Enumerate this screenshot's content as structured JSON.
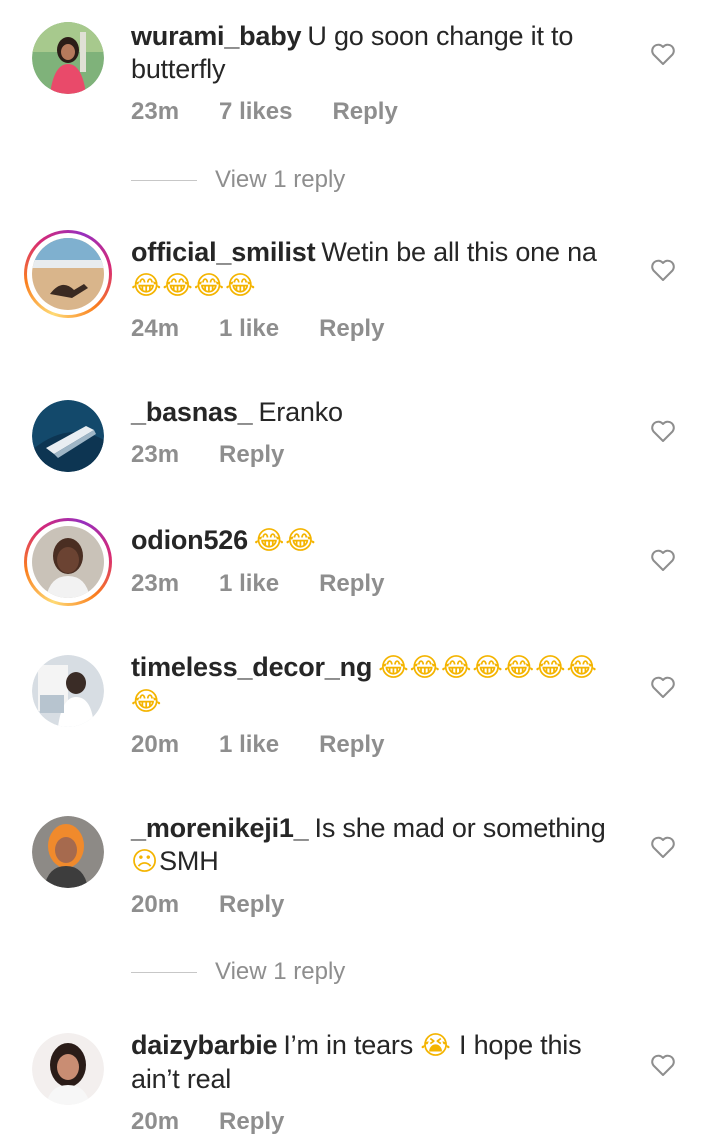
{
  "comments": [
    {
      "username": "wurami_baby",
      "text_1": "U go soon change it to",
      "text_2": "butterfly",
      "time": "23m",
      "likes": "7 likes",
      "reply": "Reply"
    },
    {
      "username": "official_smilist",
      "text_1": "Wetin be all this one na",
      "emoji": "😂😂😂😂",
      "time": "24m",
      "likes": "1 like",
      "reply": "Reply"
    },
    {
      "username": "_basnas_",
      "text_1": "Eranko",
      "time": "23m",
      "reply": "Reply"
    },
    {
      "username": "odion526",
      "emoji": "😂😂",
      "time": "23m",
      "likes": "1 like",
      "reply": "Reply"
    },
    {
      "username": "timeless_decor_ng",
      "emoji_1": "😂😂😂😂😂😂😂",
      "emoji_2": "😂",
      "time": "20m",
      "likes": "1 like",
      "reply": "Reply"
    },
    {
      "username": "_morenikeji1_",
      "text_1": "Is she mad or something",
      "emoji": "☹",
      "text_2": "SMH",
      "time": "20m",
      "reply": "Reply"
    },
    {
      "username": "daizybarbie",
      "text_1a": "I’m in tears",
      "emoji": "😭",
      "text_1b": "I hope this",
      "text_2": "ain’t real",
      "time": "20m",
      "reply": "Reply"
    }
  ],
  "view_replies": [
    "View 1 reply",
    "View 1 reply"
  ],
  "icons": {
    "like": "heart-outline-icon"
  }
}
